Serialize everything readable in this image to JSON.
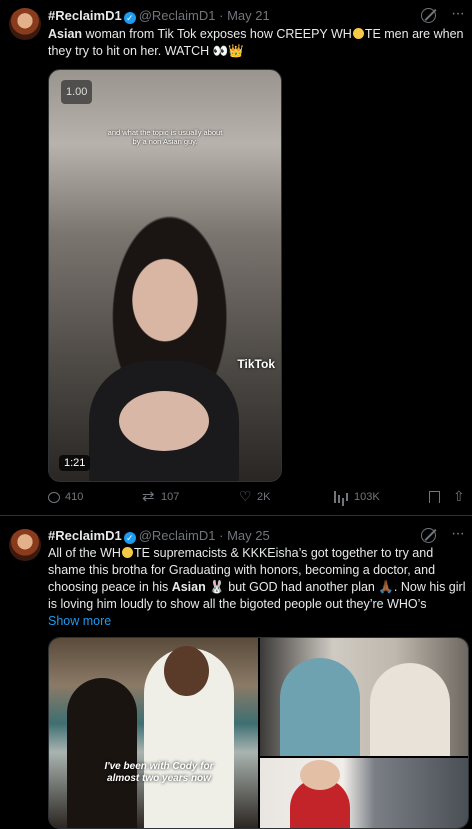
{
  "tweets": [
    {
      "name": "#ReclaimD1",
      "handle": "@ReclaimD1",
      "separator": "·",
      "date": "May 21",
      "text_bold": "Asian",
      "text_rest": " woman from Tik Tok exposes how CREEPY WH",
      "text_after_emoji": "TE men are when they try to hit on her. WATCH 👀👑",
      "video": {
        "badge": "1.00",
        "caption": "and what the topic is usually about by a non Asian guy.",
        "watermark": "TikTok",
        "duration": "1:21"
      },
      "actions": {
        "replies": "410",
        "reposts": "107",
        "likes": "2K",
        "views": "103K"
      }
    },
    {
      "name": "#ReclaimD1",
      "handle": "@ReclaimD1",
      "separator": "·",
      "date": "May 25",
      "text_part1": "All of the WH",
      "text_part2": "TE supremacists & KKKEisha’s got together to try and shame this brotha for Graduating with honors, becoming a doctor, and choosing peace in his ",
      "text_bold": "Asian",
      "text_part3": " 🐰 but GOD had another plan 🙏🏾. Now his girl is loving him loudly to show all the bigoted people out they’re WHO’s",
      "show_more": "Show more",
      "image_caption": "I've been with Cody for almost two years now"
    }
  ],
  "colors": {
    "accent": "#1d9bf0",
    "muted": "#71767b",
    "text": "#e7e9ea",
    "divider": "#2f3336"
  }
}
